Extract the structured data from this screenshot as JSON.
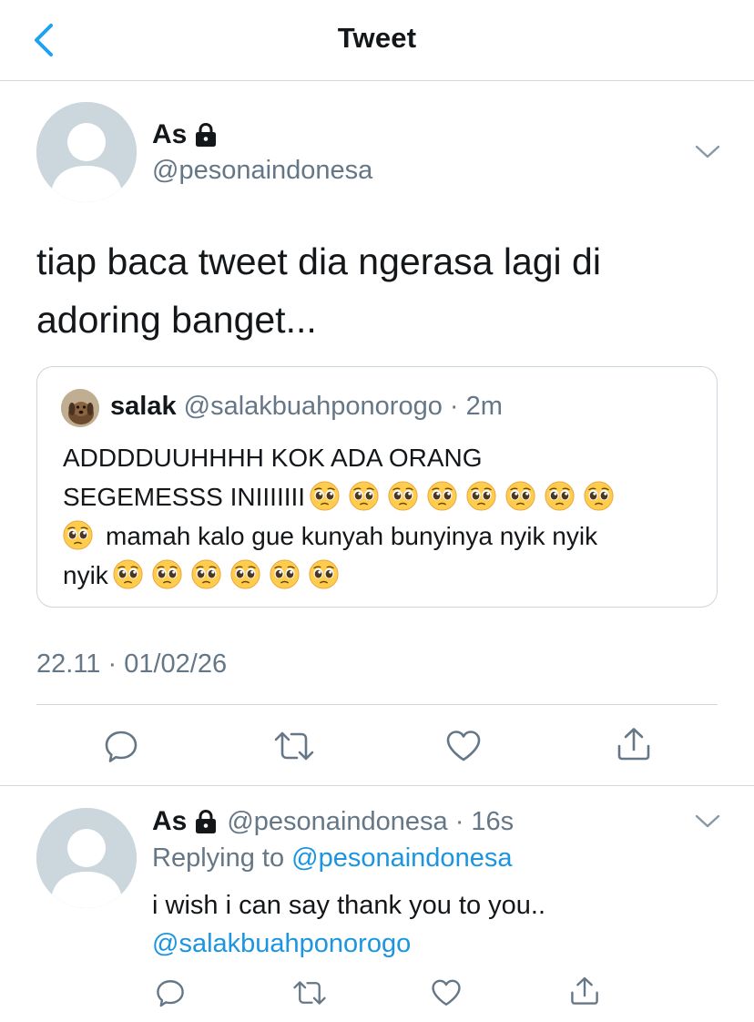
{
  "nav": {
    "title": "Tweet"
  },
  "main_tweet": {
    "author_name": "As",
    "author_handle": "@pesonaindonesa",
    "text_line1": "tiap baca tweet dia ngerasa lagi di",
    "text_line2": "adoring banget...",
    "timestamp": "22.11 · 01/02/26"
  },
  "quoted_tweet": {
    "author_name": "salak",
    "meta": "@salakbuahponorogo · 2m",
    "line1": "ADDDDUUHHHH KOK ADA ORANG",
    "line2": "SEGEMESSS INIIIIIII",
    "line3": "mamah kalo gue kunyah bunyinya nyik nyik",
    "line4": "nyik"
  },
  "reply": {
    "author_name": "As",
    "meta": "@pesonaindonesa · 16s",
    "replying_prefix": "Replying to ",
    "replying_handle": "@pesonaindonesa",
    "text": "i wish i can say thank you to you..",
    "mention": "@salakbuahponorogo"
  },
  "icons": {
    "back": "chevron-left-icon",
    "lock": "lock-icon",
    "menu": "chevron-down-icon",
    "reply": "reply-icon",
    "retweet": "retweet-icon",
    "like": "heart-icon",
    "share": "share-icon",
    "emoji": "pleading-face-emoji"
  },
  "colors": {
    "accent": "#1da1f2",
    "link": "#1b95e0",
    "muted": "#657786",
    "divider": "#d6d9dc",
    "avatar_placeholder": "#ccd6dd"
  }
}
